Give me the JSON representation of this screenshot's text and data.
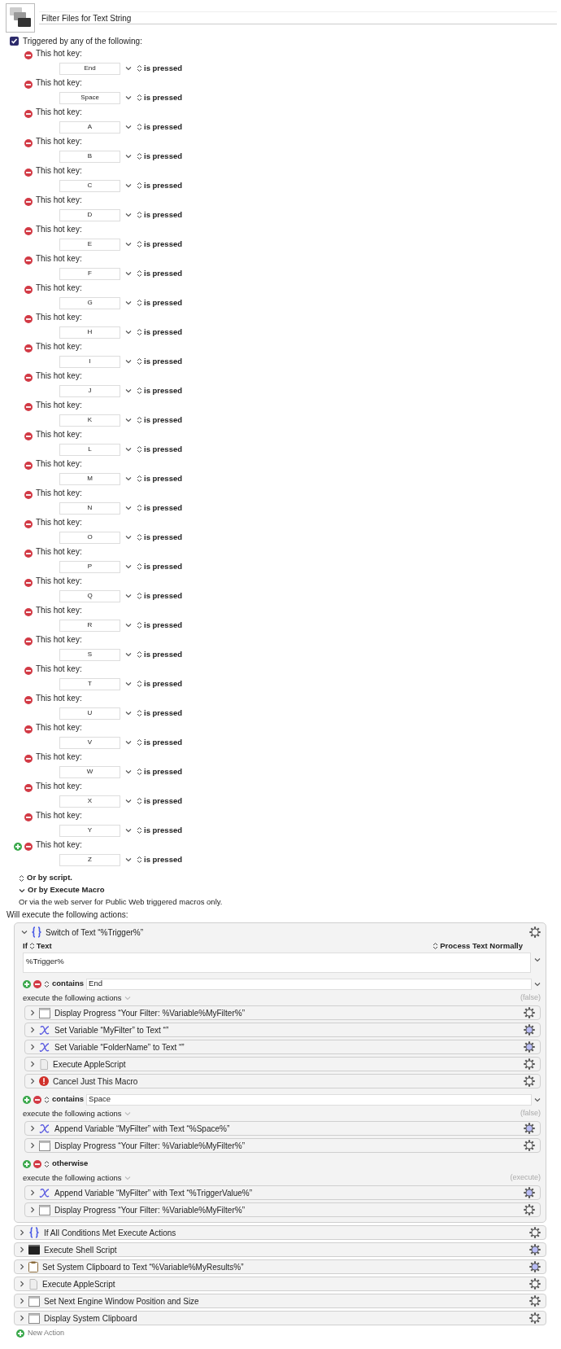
{
  "macro": {
    "title": "Filter Files for Text String"
  },
  "triggers": {
    "checked": true,
    "label": "Triggered by any of the following:",
    "hot_keys": [
      {
        "label": "This hot key:",
        "key": "End",
        "condition": "is pressed",
        "add_button": false
      },
      {
        "label": "This hot key:",
        "key": "Space",
        "condition": "is pressed",
        "add_button": false
      },
      {
        "label": "This hot key:",
        "key": "A",
        "condition": "is pressed",
        "add_button": false
      },
      {
        "label": "This hot key:",
        "key": "B",
        "condition": "is pressed",
        "add_button": false
      },
      {
        "label": "This hot key:",
        "key": "C",
        "condition": "is pressed",
        "add_button": false
      },
      {
        "label": "This hot key:",
        "key": "D",
        "condition": "is pressed",
        "add_button": false
      },
      {
        "label": "This hot key:",
        "key": "E",
        "condition": "is pressed",
        "add_button": false
      },
      {
        "label": "This hot key:",
        "key": "F",
        "condition": "is pressed",
        "add_button": false
      },
      {
        "label": "This hot key:",
        "key": "G",
        "condition": "is pressed",
        "add_button": false
      },
      {
        "label": "This hot key:",
        "key": "H",
        "condition": "is pressed",
        "add_button": false
      },
      {
        "label": "This hot key:",
        "key": "I",
        "condition": "is pressed",
        "add_button": false
      },
      {
        "label": "This hot key:",
        "key": "J",
        "condition": "is pressed",
        "add_button": false
      },
      {
        "label": "This hot key:",
        "key": "K",
        "condition": "is pressed",
        "add_button": false
      },
      {
        "label": "This hot key:",
        "key": "L",
        "condition": "is pressed",
        "add_button": false
      },
      {
        "label": "This hot key:",
        "key": "M",
        "condition": "is pressed",
        "add_button": false
      },
      {
        "label": "This hot key:",
        "key": "N",
        "condition": "is pressed",
        "add_button": false
      },
      {
        "label": "This hot key:",
        "key": "O",
        "condition": "is pressed",
        "add_button": false
      },
      {
        "label": "This hot key:",
        "key": "P",
        "condition": "is pressed",
        "add_button": false
      },
      {
        "label": "This hot key:",
        "key": "Q",
        "condition": "is pressed",
        "add_button": false
      },
      {
        "label": "This hot key:",
        "key": "R",
        "condition": "is pressed",
        "add_button": false
      },
      {
        "label": "This hot key:",
        "key": "S",
        "condition": "is pressed",
        "add_button": false
      },
      {
        "label": "This hot key:",
        "key": "T",
        "condition": "is pressed",
        "add_button": false
      },
      {
        "label": "This hot key:",
        "key": "U",
        "condition": "is pressed",
        "add_button": false
      },
      {
        "label": "This hot key:",
        "key": "V",
        "condition": "is pressed",
        "add_button": false
      },
      {
        "label": "This hot key:",
        "key": "W",
        "condition": "is pressed",
        "add_button": false
      },
      {
        "label": "This hot key:",
        "key": "X",
        "condition": "is pressed",
        "add_button": false
      },
      {
        "label": "This hot key:",
        "key": "Y",
        "condition": "is pressed",
        "add_button": false
      },
      {
        "label": "This hot key:",
        "key": "Z",
        "condition": "is pressed",
        "add_button": true
      }
    ]
  },
  "other_triggers": [
    {
      "kind": "popup",
      "label": "Or by script."
    },
    {
      "kind": "disclosure",
      "label": "Or by Execute Macro"
    },
    {
      "kind": "note",
      "label": "Or via the web server for Public Web triggered macros only."
    }
  ],
  "actions_heading": "Will execute the following actions:",
  "switch": {
    "expanded": true,
    "title": "Switch of Text “%Trigger%”",
    "if_label": "If",
    "source": "Text",
    "process": "Process Text Normally",
    "text": "%Trigger%",
    "cases": [
      {
        "kind": "contains",
        "operator": "contains",
        "value": "End",
        "execute_label": "execute the following actions",
        "result": "(false)",
        "actions": [
          {
            "kind": "window",
            "title": "Display Progress “Your Filter: %Variable%MyFilter%”",
            "gear_highlighted": false
          },
          {
            "kind": "variable",
            "title": "Set Variable “MyFilter” to Text “”",
            "gear_highlighted": true
          },
          {
            "kind": "variable",
            "title": "Set Variable “FolderName” to Text “”",
            "gear_highlighted": true
          },
          {
            "kind": "script",
            "title": "Execute AppleScript",
            "gear_highlighted": false
          },
          {
            "kind": "cancel",
            "title": "Cancel Just This Macro",
            "gear_highlighted": false
          }
        ]
      },
      {
        "kind": "contains",
        "operator": "contains",
        "value": "Space",
        "execute_label": "execute the following actions",
        "result": "(false)",
        "actions": [
          {
            "kind": "variable",
            "title": "Append Variable “MyFilter” with Text “%Space%”",
            "gear_highlighted": true
          },
          {
            "kind": "window",
            "title": "Display Progress “Your Filter: %Variable%MyFilter%”",
            "gear_highlighted": false
          }
        ]
      },
      {
        "kind": "otherwise",
        "operator": "otherwise",
        "execute_label": "execute the following actions",
        "result": "(execute)",
        "actions": [
          {
            "kind": "variable",
            "title": "Append Variable “MyFilter” with Text “%TriggerValue%”",
            "gear_highlighted": true
          },
          {
            "kind": "window",
            "title": "Display Progress “Your Filter: %Variable%MyFilter%”",
            "gear_highlighted": false
          }
        ]
      }
    ]
  },
  "actions": [
    {
      "kind": "braces",
      "title": "If All Conditions Met Execute Actions",
      "gear_highlighted": false
    },
    {
      "kind": "terminal",
      "title": "Execute Shell Script",
      "gear_highlighted": true
    },
    {
      "kind": "clipboard",
      "title": "Set System Clipboard to Text “%Variable%MyResults%”",
      "gear_highlighted": true
    },
    {
      "kind": "script",
      "title": "Execute AppleScript",
      "gear_highlighted": false
    },
    {
      "kind": "window",
      "title": "Set Next Engine Window Position and Size",
      "gear_highlighted": false
    },
    {
      "kind": "window",
      "title": "Display System Clipboard",
      "gear_highlighted": false
    }
  ],
  "new_action": "New Action"
}
